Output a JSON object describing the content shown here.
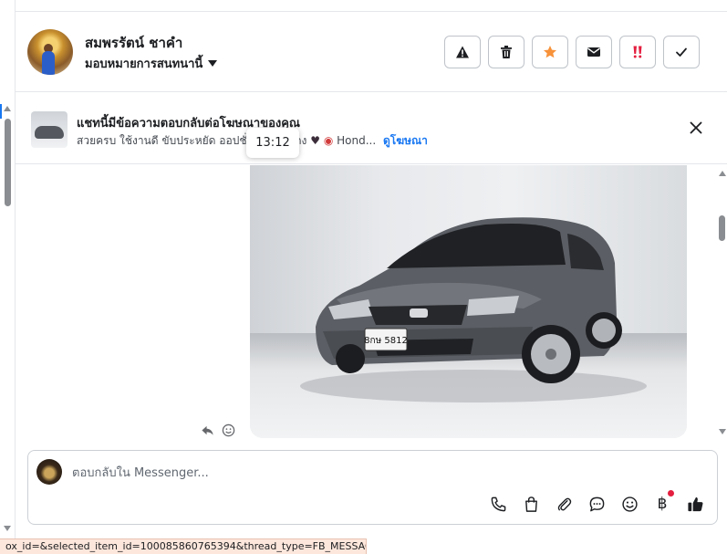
{
  "header": {
    "contact_name": "สมพรรัตน์ ชาคำ",
    "assign_label": "มอบหมายการสนทนานี้",
    "actions": [
      {
        "name": "report-button",
        "icon": "warning-icon"
      },
      {
        "name": "delete-button",
        "icon": "trash-icon"
      },
      {
        "name": "star-button",
        "icon": "star-icon",
        "color": "#f7923a"
      },
      {
        "name": "mark-unread-button",
        "icon": "envelope-icon"
      },
      {
        "name": "spam-button",
        "icon": "double-exclamation-icon",
        "color": "#e41e3f"
      },
      {
        "name": "done-button",
        "icon": "check-icon"
      }
    ]
  },
  "ad_banner": {
    "title": "แชทนี้มีข้อความตอบกลับต่อโฆษณาของคุณ",
    "subtitle_prefix": "สวยครบ ใช้งานดี ขับประหยัด ออปชั่นแ",
    "subtitle_suffix": "อป้ายแดง",
    "subtitle_tail": "Hond...",
    "link": "ดูโฆษณา",
    "tooltip_time": "13:12"
  },
  "conversation": {
    "photo_alt": "car",
    "plate_text": "8กษ 5812"
  },
  "composer": {
    "placeholder": "ตอบกลับใน Messenger...",
    "currency_symbol": "฿"
  },
  "status_url": "ox_id=&selected_item_id=100085860765394&thread_type=FB_MESSAGE#",
  "colors": {
    "accent": "#1877f2",
    "star": "#f7923a",
    "spam": "#e41e3f",
    "notification_dot": "#e41e3f"
  }
}
